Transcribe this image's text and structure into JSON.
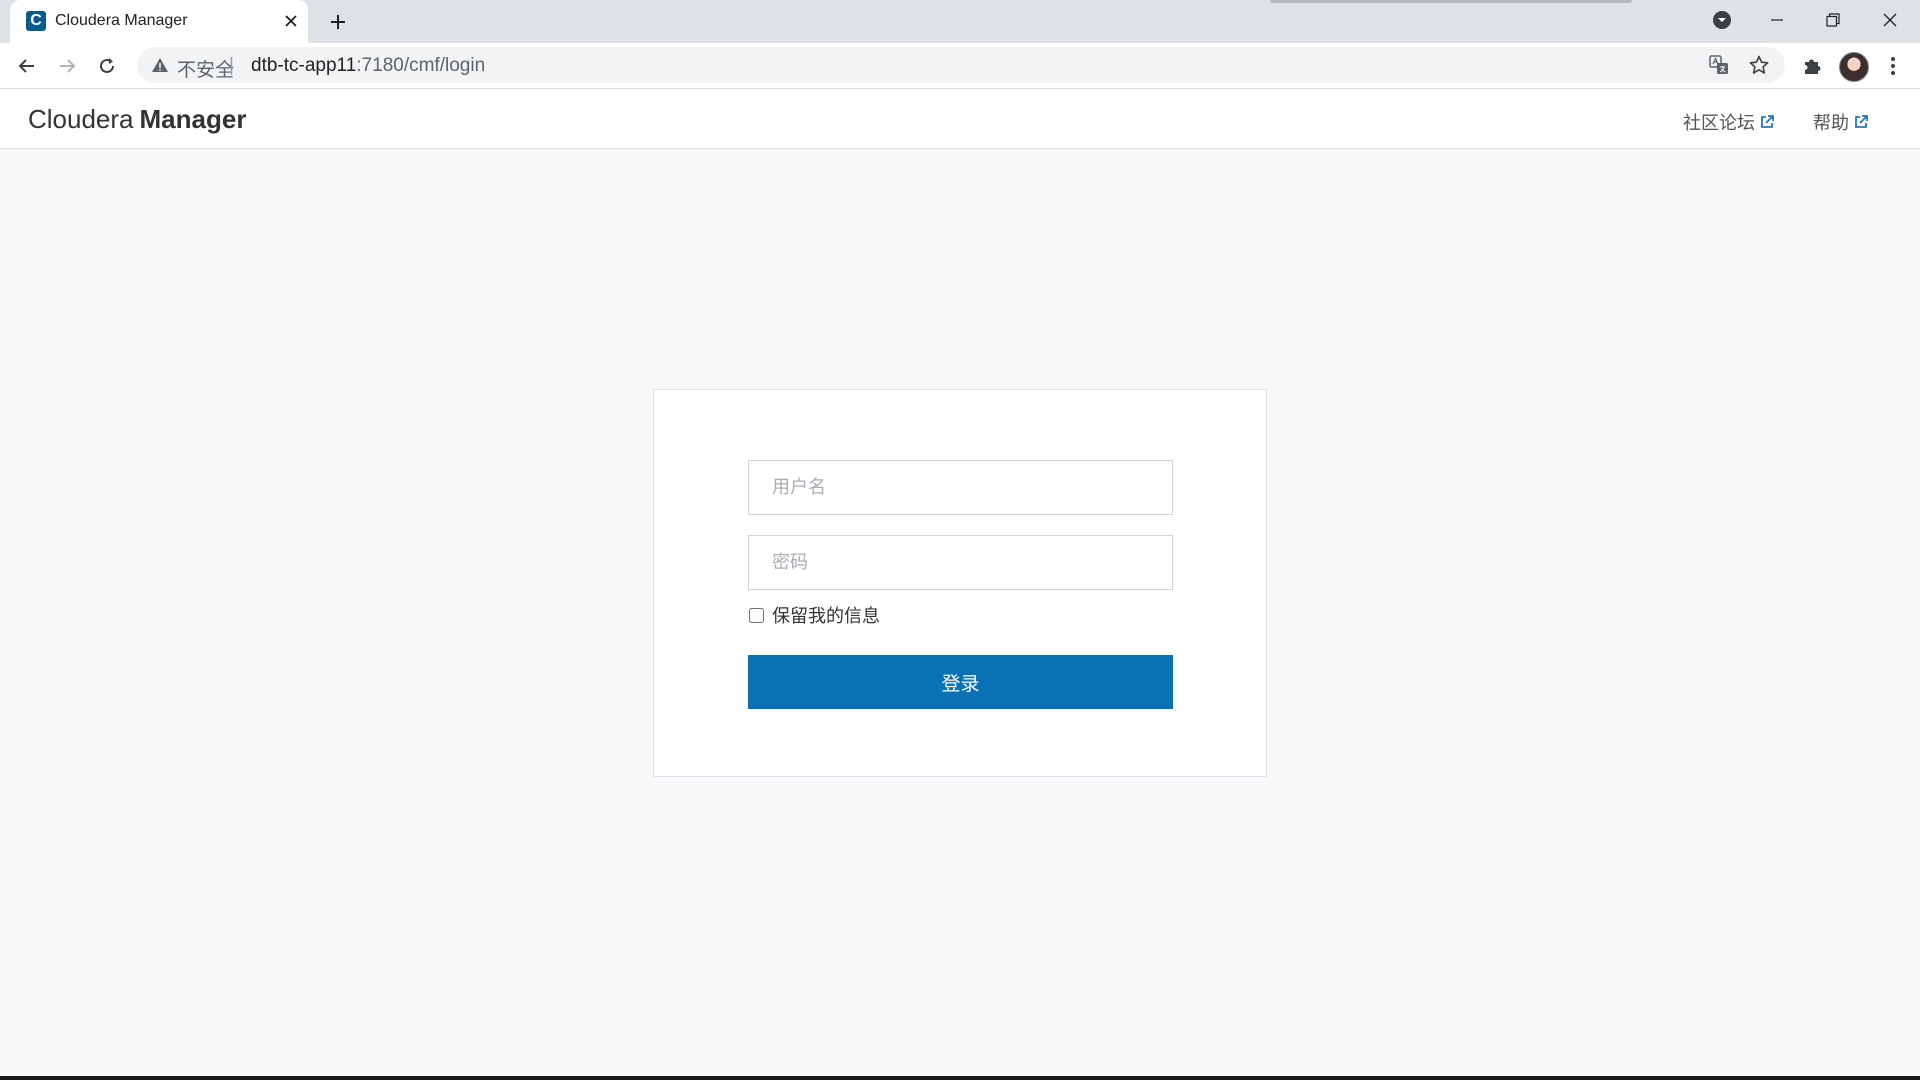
{
  "browser": {
    "tab": {
      "title": "Cloudera Manager",
      "favicon_letter": "C",
      "favicon_color": "#0a5a8c"
    },
    "omnibox": {
      "security_text": "不安全",
      "separator": "|",
      "url_host": "dtb-tc-app11",
      "url_path": ":7180/cmf/login"
    },
    "icons": {
      "back": "arrow-left-icon",
      "forward": "arrow-right-icon",
      "reload": "reload-icon",
      "translate": "translate-icon",
      "bookmark": "star-icon",
      "extensions": "puzzle-icon",
      "menu": "kebab-menu-icon"
    }
  },
  "header": {
    "brand_light": "Cloudera",
    "brand_bold": "Manager",
    "links": [
      {
        "label": "社区论坛",
        "icon": "external-link-icon"
      },
      {
        "label": "帮助",
        "icon": "external-link-icon"
      }
    ]
  },
  "login": {
    "username_placeholder": "用户名",
    "username_value": "",
    "password_placeholder": "密码",
    "password_value": "",
    "remember_label": "保留我的信息",
    "remember_checked": false,
    "submit_label": "登录",
    "accent_color": "#0a72b4"
  }
}
